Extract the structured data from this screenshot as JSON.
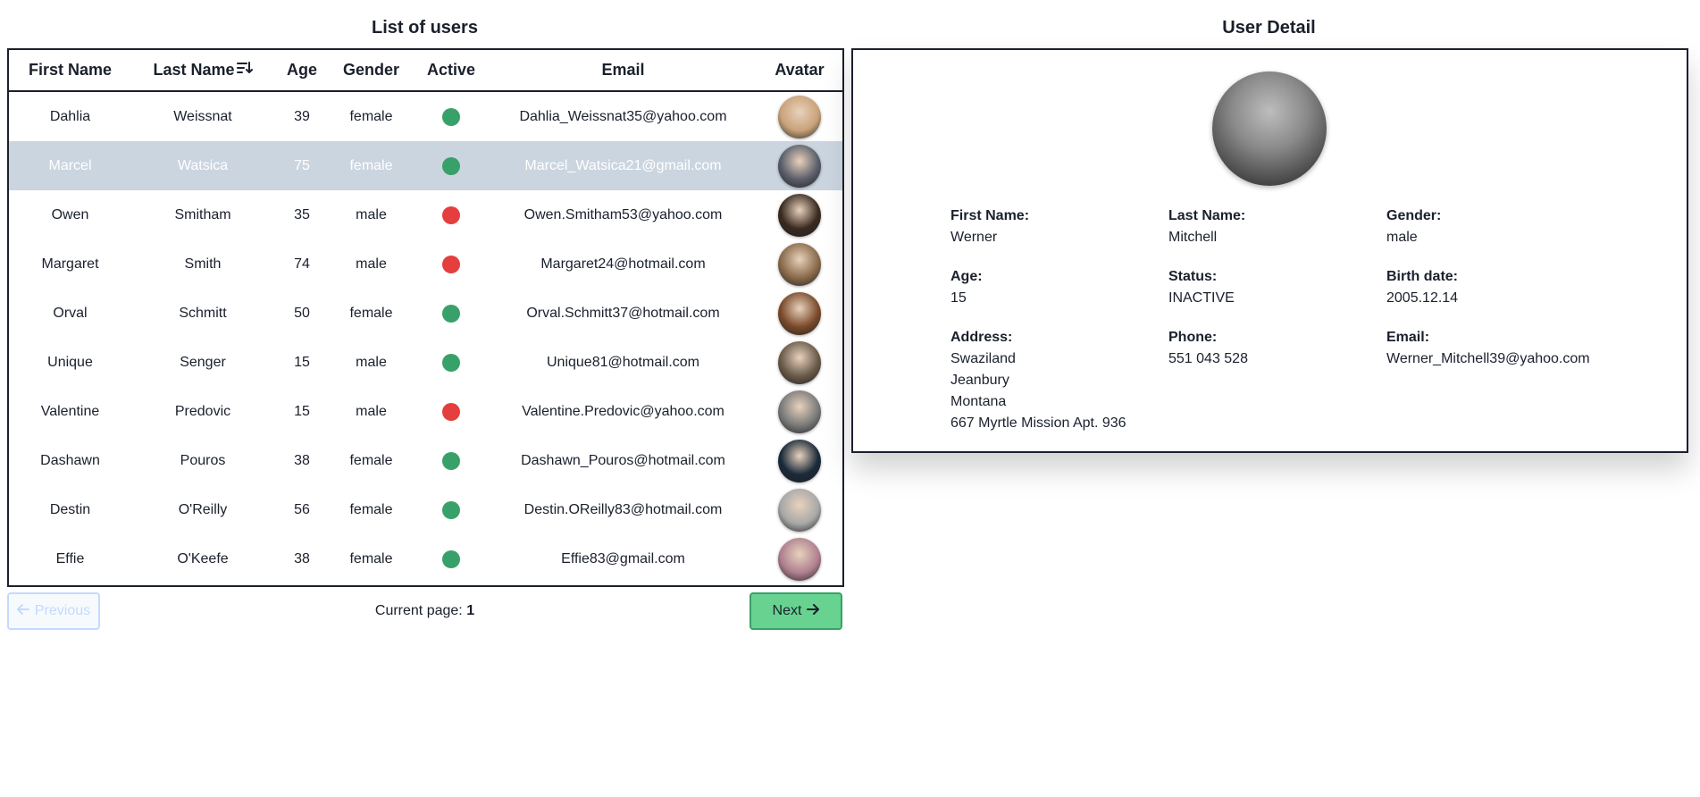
{
  "list": {
    "title": "List of users",
    "columns": [
      "First Name",
      "Last Name",
      "Age",
      "Gender",
      "Active",
      "Email",
      "Avatar"
    ],
    "rows": [
      {
        "first": "Dahlia",
        "last": "Weissnat",
        "age": "39",
        "gender": "female",
        "active": true,
        "email": "Dahlia_Weissnat35@yahoo.com",
        "avatar_color": "#c9a27a"
      },
      {
        "first": "Marcel",
        "last": "Watsica",
        "age": "75",
        "gender": "female",
        "active": true,
        "email": "Marcel_Watsica21@gmail.com",
        "avatar_color": "#5a5e6a"
      },
      {
        "first": "Owen",
        "last": "Smitham",
        "age": "35",
        "gender": "male",
        "active": false,
        "email": "Owen.Smitham53@yahoo.com",
        "avatar_color": "#3a2a20"
      },
      {
        "first": "Margaret",
        "last": "Smith",
        "age": "74",
        "gender": "male",
        "active": false,
        "email": "Margaret24@hotmail.com",
        "avatar_color": "#8a6a4a"
      },
      {
        "first": "Orval",
        "last": "Schmitt",
        "age": "50",
        "gender": "female",
        "active": true,
        "email": "Orval.Schmitt37@hotmail.com",
        "avatar_color": "#7a4a2a"
      },
      {
        "first": "Unique",
        "last": "Senger",
        "age": "15",
        "gender": "male",
        "active": true,
        "email": "Unique81@hotmail.com",
        "avatar_color": "#6a5a4a"
      },
      {
        "first": "Valentine",
        "last": "Predovic",
        "age": "15",
        "gender": "male",
        "active": false,
        "email": "Valentine.Predovic@yahoo.com",
        "avatar_color": "#7a7a7a"
      },
      {
        "first": "Dashawn",
        "last": "Pouros",
        "age": "38",
        "gender": "female",
        "active": true,
        "email": "Dashawn_Pouros@hotmail.com",
        "avatar_color": "#1a2a3a"
      },
      {
        "first": "Destin",
        "last": "O'Reilly",
        "age": "56",
        "gender": "female",
        "active": true,
        "email": "Destin.OReilly83@hotmail.com",
        "avatar_color": "#a8a8a8"
      },
      {
        "first": "Effie",
        "last": "O'Keefe",
        "age": "38",
        "gender": "female",
        "active": true,
        "email": "Effie83@gmail.com",
        "avatar_color": "#b08090"
      }
    ],
    "selected_index": 1
  },
  "pagination": {
    "prev_label": "Previous",
    "next_label": "Next",
    "current_label": "Current page:",
    "current_page": "1"
  },
  "detail": {
    "title": "User Detail",
    "first_name_label": "First Name:",
    "first_name": "Werner",
    "last_name_label": "Last Name:",
    "last_name": "Mitchell",
    "gender_label": "Gender:",
    "gender": "male",
    "age_label": "Age:",
    "age": "15",
    "status_label": "Status:",
    "status": "INACTIVE",
    "birth_label": "Birth date:",
    "birth": "2005.12.14",
    "address_label": "Address:",
    "address": [
      "Swaziland",
      "Jeanbury",
      "Montana",
      "667 Myrtle Mission Apt. 936"
    ],
    "phone_label": "Phone:",
    "phone": "551 043 528",
    "email_label": "Email:",
    "email": "Werner_Mitchell39@yahoo.com"
  },
  "colors": {
    "active": "#38a169",
    "inactive": "#e53e3e",
    "selected_row": "#cbd5e0",
    "next_button": "#68d391"
  },
  "icons": {
    "sort": "sort-descending-icon",
    "prev": "arrow-left-icon",
    "next": "arrow-right-icon"
  }
}
